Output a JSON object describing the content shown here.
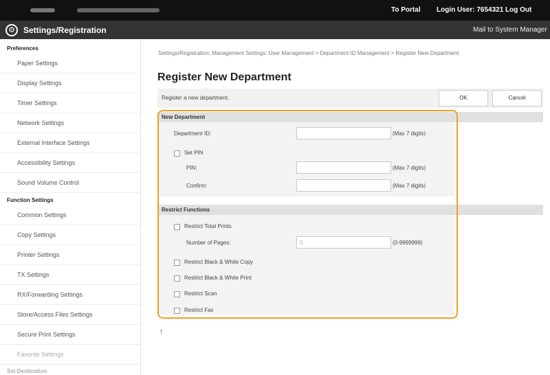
{
  "topbar": {
    "portal_link": "To Portal",
    "login_user": "Login User:  7654321  Log Out"
  },
  "header": {
    "title": "Settings/Registration",
    "mail_link": "Mail to System Manager"
  },
  "sidebar": {
    "sections": [
      {
        "title": "Preferences",
        "items": [
          "Paper Settings",
          "Display Settings",
          "Timer Settings",
          "Network Settings",
          "External Interface Settings",
          "Accessibility Settings",
          "Sound Volume Control"
        ]
      },
      {
        "title": "Function Settings",
        "items": [
          "Common Settings",
          "Copy Settings",
          "Printer Settings",
          "TX Settings",
          "RX/Forwarding Settings",
          "Store/Access Files Settings",
          "Secure Print Settings",
          "Favorite Settings"
        ]
      },
      {
        "title": "Set Destination",
        "items": []
      }
    ]
  },
  "main": {
    "breadcrumb": "Settings/Registration: Management Settings: User Management > Department ID Management > Register New Department",
    "title": "Register New Department",
    "description": "Register a new department.",
    "ok_label": "OK",
    "cancel_label": "Cancel",
    "new_department": {
      "heading": "New Department",
      "department_id_label": "Department ID:",
      "department_id_value": "",
      "department_id_hint": "(Max 7 digits)",
      "set_pin_label": "Set PIN",
      "pin_label": "PIN:",
      "pin_value": "",
      "pin_hint": "(Max 7 digits)",
      "confirm_label": "Confirm:",
      "confirm_value": "",
      "confirm_hint": "(Max 7 digits)"
    },
    "restrict_functions": {
      "heading": "Restrict Functions",
      "total_prints_label": "Restrict Total Prints",
      "pages_label": "Number of Pages:",
      "pages_value": "0",
      "pages_hint": "(0-9999999)",
      "bw_copy_label": "Restrict Black & White Copy",
      "bw_print_label": "Restrict Black & White Print",
      "scan_label": "Restrict Scan",
      "fax_label": "Restrict Fax"
    },
    "top_link": "↑"
  },
  "colors": {
    "highlight": "#f0a020",
    "title_bar": "#333333",
    "top_bar": "#111111"
  }
}
